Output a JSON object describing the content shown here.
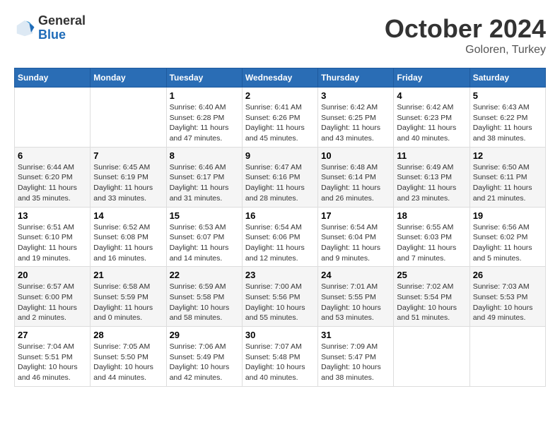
{
  "header": {
    "logo_general": "General",
    "logo_blue": "Blue",
    "month": "October 2024",
    "location": "Goloren, Turkey"
  },
  "days_of_week": [
    "Sunday",
    "Monday",
    "Tuesday",
    "Wednesday",
    "Thursday",
    "Friday",
    "Saturday"
  ],
  "weeks": [
    [
      {
        "day": "",
        "info": ""
      },
      {
        "day": "",
        "info": ""
      },
      {
        "day": "1",
        "sunrise": "6:40 AM",
        "sunset": "6:28 PM",
        "daylight": "11 hours and 47 minutes."
      },
      {
        "day": "2",
        "sunrise": "6:41 AM",
        "sunset": "6:26 PM",
        "daylight": "11 hours and 45 minutes."
      },
      {
        "day": "3",
        "sunrise": "6:42 AM",
        "sunset": "6:25 PM",
        "daylight": "11 hours and 43 minutes."
      },
      {
        "day": "4",
        "sunrise": "6:42 AM",
        "sunset": "6:23 PM",
        "daylight": "11 hours and 40 minutes."
      },
      {
        "day": "5",
        "sunrise": "6:43 AM",
        "sunset": "6:22 PM",
        "daylight": "11 hours and 38 minutes."
      }
    ],
    [
      {
        "day": "6",
        "sunrise": "6:44 AM",
        "sunset": "6:20 PM",
        "daylight": "11 hours and 35 minutes."
      },
      {
        "day": "7",
        "sunrise": "6:45 AM",
        "sunset": "6:19 PM",
        "daylight": "11 hours and 33 minutes."
      },
      {
        "day": "8",
        "sunrise": "6:46 AM",
        "sunset": "6:17 PM",
        "daylight": "11 hours and 31 minutes."
      },
      {
        "day": "9",
        "sunrise": "6:47 AM",
        "sunset": "6:16 PM",
        "daylight": "11 hours and 28 minutes."
      },
      {
        "day": "10",
        "sunrise": "6:48 AM",
        "sunset": "6:14 PM",
        "daylight": "11 hours and 26 minutes."
      },
      {
        "day": "11",
        "sunrise": "6:49 AM",
        "sunset": "6:13 PM",
        "daylight": "11 hours and 23 minutes."
      },
      {
        "day": "12",
        "sunrise": "6:50 AM",
        "sunset": "6:11 PM",
        "daylight": "11 hours and 21 minutes."
      }
    ],
    [
      {
        "day": "13",
        "sunrise": "6:51 AM",
        "sunset": "6:10 PM",
        "daylight": "11 hours and 19 minutes."
      },
      {
        "day": "14",
        "sunrise": "6:52 AM",
        "sunset": "6:08 PM",
        "daylight": "11 hours and 16 minutes."
      },
      {
        "day": "15",
        "sunrise": "6:53 AM",
        "sunset": "6:07 PM",
        "daylight": "11 hours and 14 minutes."
      },
      {
        "day": "16",
        "sunrise": "6:54 AM",
        "sunset": "6:06 PM",
        "daylight": "11 hours and 12 minutes."
      },
      {
        "day": "17",
        "sunrise": "6:54 AM",
        "sunset": "6:04 PM",
        "daylight": "11 hours and 9 minutes."
      },
      {
        "day": "18",
        "sunrise": "6:55 AM",
        "sunset": "6:03 PM",
        "daylight": "11 hours and 7 minutes."
      },
      {
        "day": "19",
        "sunrise": "6:56 AM",
        "sunset": "6:02 PM",
        "daylight": "11 hours and 5 minutes."
      }
    ],
    [
      {
        "day": "20",
        "sunrise": "6:57 AM",
        "sunset": "6:00 PM",
        "daylight": "11 hours and 2 minutes."
      },
      {
        "day": "21",
        "sunrise": "6:58 AM",
        "sunset": "5:59 PM",
        "daylight": "11 hours and 0 minutes."
      },
      {
        "day": "22",
        "sunrise": "6:59 AM",
        "sunset": "5:58 PM",
        "daylight": "10 hours and 58 minutes."
      },
      {
        "day": "23",
        "sunrise": "7:00 AM",
        "sunset": "5:56 PM",
        "daylight": "10 hours and 55 minutes."
      },
      {
        "day": "24",
        "sunrise": "7:01 AM",
        "sunset": "5:55 PM",
        "daylight": "10 hours and 53 minutes."
      },
      {
        "day": "25",
        "sunrise": "7:02 AM",
        "sunset": "5:54 PM",
        "daylight": "10 hours and 51 minutes."
      },
      {
        "day": "26",
        "sunrise": "7:03 AM",
        "sunset": "5:53 PM",
        "daylight": "10 hours and 49 minutes."
      }
    ],
    [
      {
        "day": "27",
        "sunrise": "7:04 AM",
        "sunset": "5:51 PM",
        "daylight": "10 hours and 46 minutes."
      },
      {
        "day": "28",
        "sunrise": "7:05 AM",
        "sunset": "5:50 PM",
        "daylight": "10 hours and 44 minutes."
      },
      {
        "day": "29",
        "sunrise": "7:06 AM",
        "sunset": "5:49 PM",
        "daylight": "10 hours and 42 minutes."
      },
      {
        "day": "30",
        "sunrise": "7:07 AM",
        "sunset": "5:48 PM",
        "daylight": "10 hours and 40 minutes."
      },
      {
        "day": "31",
        "sunrise": "7:09 AM",
        "sunset": "5:47 PM",
        "daylight": "10 hours and 38 minutes."
      },
      {
        "day": "",
        "info": ""
      },
      {
        "day": "",
        "info": ""
      }
    ]
  ]
}
